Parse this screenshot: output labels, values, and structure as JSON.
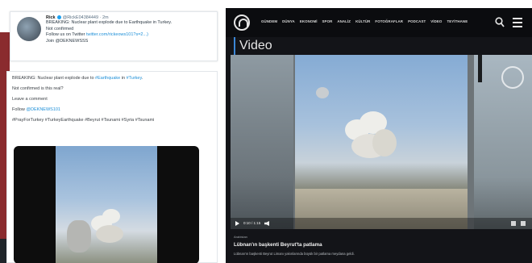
{
  "tweet": {
    "author_name": "Rick",
    "author_handle": "@RickE04384449",
    "age": "· 2m",
    "lines": [
      "BREAKING: Nuclear plant explode due to Earthquake in Turkey.",
      "Not confirmed"
    ],
    "follow_prefix": "Follow us on Twitter ",
    "follow_link": "twitter.com/rickeows101?s=2...)",
    "join_line": "Join @DEKNEWSSS"
  },
  "post": {
    "line1_prefix": "BREAKING: Nuclear plant explode due to ",
    "line1_link": "#Earthquake",
    "line1_mid": " in ",
    "line1_link2": "#Turkey",
    "line1_suffix": ".",
    "line2": "Not confirmed is this real?",
    "line3": "Leave a comment",
    "follow_prefix": "Follow ",
    "follow_link": "@DEKNEWS101",
    "hashtags": "#PrayForTurkey #TurkeyEarthquake #Beyrut #Tsunami #Syria #Tsunami"
  },
  "site": {
    "nav": [
      "GÜNDEM",
      "DÜNYA",
      "EKONOMİ",
      "SPOR",
      "ANALİZ",
      "KÜLTÜR",
      "FOTOĞRAFLAR",
      "PODCAST",
      "VİDEO",
      "TEYİTHANE"
    ],
    "section_heading": "Video",
    "player": {
      "time": "0:10 / 1:15"
    },
    "caption_label": "Arabistan",
    "caption_title": "Lübnan'ın başkenti Beyrut'ta patlama",
    "caption_desc": "Lübnan'ın başkenti Beyrut Limanı yakınlarında büyük bir patlama meydana geldi."
  },
  "colors": {
    "accent_blue": "#3b86d6",
    "link_blue": "#1d8fd8",
    "left_strip_red": "#8a2b2e",
    "site_background": "#131418"
  }
}
